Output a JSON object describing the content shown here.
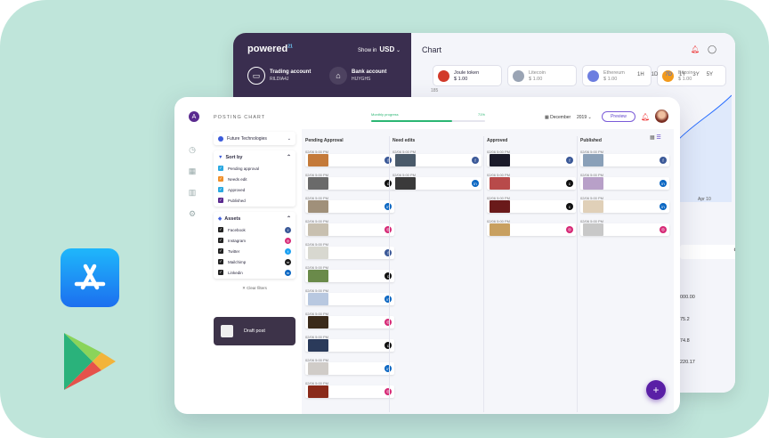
{
  "back": {
    "logo": "powered",
    "logo_sup": "21",
    "show_in": "Show in",
    "currency": "USD",
    "accounts": [
      {
        "name": "Trading account",
        "id": "RILDIA4J"
      },
      {
        "name": "Bank account",
        "id": "HUYGHS"
      }
    ],
    "chart_title": "Chart",
    "tokens": [
      {
        "name": "Joule token",
        "price": "$ 1.00",
        "color": "#d23a2a"
      },
      {
        "name": "Litecoin",
        "price": "$ 1.00",
        "color": "#9aa4b4"
      },
      {
        "name": "Ethereum",
        "price": "$ 1.00",
        "color": "#6d7ee0"
      },
      {
        "name": "Bitcoin",
        "price": "$ 1.00",
        "color": "#f29a1c"
      }
    ],
    "timeframes": [
      "1H",
      "1D",
      "7D",
      "1Y",
      "3Y",
      "5Y"
    ],
    "active_timeframe": "7D",
    "axis_value": "185",
    "axis_date": "Apr 10",
    "values": [
      "000.00",
      "75.2",
      "74.8",
      "220.17"
    ]
  },
  "front": {
    "title": "POSTING CHART",
    "progress_label": "Monthly progress",
    "progress_pct": "71%",
    "progress_value": 0.71,
    "month": "December",
    "year": "2019",
    "preview": "Preview",
    "workspace": "Future Technologies",
    "sort_title": "Sort by",
    "sort_items": [
      {
        "label": "Pending approval",
        "color": "#2aa8e0"
      },
      {
        "label": "Needs edit",
        "color": "#f0902a"
      },
      {
        "label": "Approved",
        "color": "#2aa8e0"
      },
      {
        "label": "Published",
        "color": "#5a2a8f"
      }
    ],
    "assets_title": "Assets",
    "assets": [
      {
        "label": "Facebook",
        "icon": "facebook-icon",
        "color": "#3b5998",
        "g": "f"
      },
      {
        "label": "Instagram",
        "icon": "instagram-icon",
        "color": "#d62976",
        "g": "◎"
      },
      {
        "label": "Twitter",
        "icon": "twitter-icon",
        "color": "#1da1f2",
        "g": "t"
      },
      {
        "label": "Mailchimp",
        "icon": "mailchimp-icon",
        "color": "#1a1a1a",
        "g": "m"
      },
      {
        "label": "Linkedin",
        "icon": "linkedin-icon",
        "color": "#0a66c2",
        "g": "in"
      }
    ],
    "clear_filters": "Clear filters",
    "draft": "Draft post",
    "columns": [
      {
        "title": "Pending Approval",
        "cards": [
          {
            "date": "02/06 5:00 PM",
            "soc": "f",
            "sc": "#3b5998",
            "th": "#c47a3a"
          },
          {
            "date": "02/06 5:00 PM",
            "soc": "c",
            "sc": "#111",
            "th": "#6a6a6a"
          },
          {
            "date": "02/06 5:00 PM",
            "soc": "in",
            "sc": "#0a66c2",
            "th": "#a0907a"
          },
          {
            "date": "02/06 5:00 PM",
            "soc": "◎",
            "sc": "#d62976",
            "th": "#c8c0b0"
          },
          {
            "date": "02/06 5:00 PM",
            "soc": "f",
            "sc": "#3b5998",
            "th": "#d8d8d0"
          },
          {
            "date": "02/06 5:00 PM",
            "soc": "c",
            "sc": "#111",
            "th": "#6a8a4a"
          },
          {
            "date": "02/06 5:00 PM",
            "soc": "in",
            "sc": "#0a66c2",
            "th": "#b8c8e0"
          },
          {
            "date": "02/06 5:00 PM",
            "soc": "◎",
            "sc": "#d62976",
            "th": "#3a2a1a"
          },
          {
            "date": "02/06 5:00 PM",
            "soc": "c",
            "sc": "#111",
            "th": "#2a3a5a"
          },
          {
            "date": "02/06 5:00 PM",
            "soc": "in",
            "sc": "#0a66c2",
            "th": "#d0ccc8"
          },
          {
            "date": "02/06 5:00 PM",
            "soc": "◎",
            "sc": "#d62976",
            "th": "#8a2a1a"
          }
        ]
      },
      {
        "title": "Need edits",
        "cards": [
          {
            "date": "02/06 5:00 PM",
            "soc": "f",
            "sc": "#3b5998",
            "th": "#4a5a6a"
          },
          {
            "date": "02/06 5:00 PM",
            "soc": "in",
            "sc": "#0a66c2",
            "th": "#3a3a3a"
          }
        ]
      },
      {
        "title": "Approved",
        "cards": [
          {
            "date": "02/06 5:00 PM",
            "soc": "f",
            "sc": "#3b5998",
            "th": "#1a1a2a"
          },
          {
            "date": "02/06 5:00 PM",
            "soc": "c",
            "sc": "#111",
            "th": "#b84a4a"
          },
          {
            "date": "02/06 5:00 PM",
            "soc": "c",
            "sc": "#111",
            "th": "#6a1a1a"
          },
          {
            "date": "02/06 5:00 PM",
            "soc": "◎",
            "sc": "#d62976",
            "th": "#c8a060"
          }
        ]
      },
      {
        "title": "Published",
        "cards": [
          {
            "date": "02/06 5:00 PM",
            "soc": "f",
            "sc": "#3b5998",
            "th": "#8aa0b8"
          },
          {
            "date": "02/06 5:00 PM",
            "soc": "in",
            "sc": "#0a66c2",
            "th": "#b8a0c8"
          },
          {
            "date": "02/06 5:00 PM",
            "soc": "in",
            "sc": "#0a66c2",
            "th": "#e0d0b8"
          },
          {
            "date": "02/06 5:00 PM",
            "soc": "◎",
            "sc": "#d62976",
            "th": "#c8c8c8"
          }
        ]
      }
    ]
  }
}
